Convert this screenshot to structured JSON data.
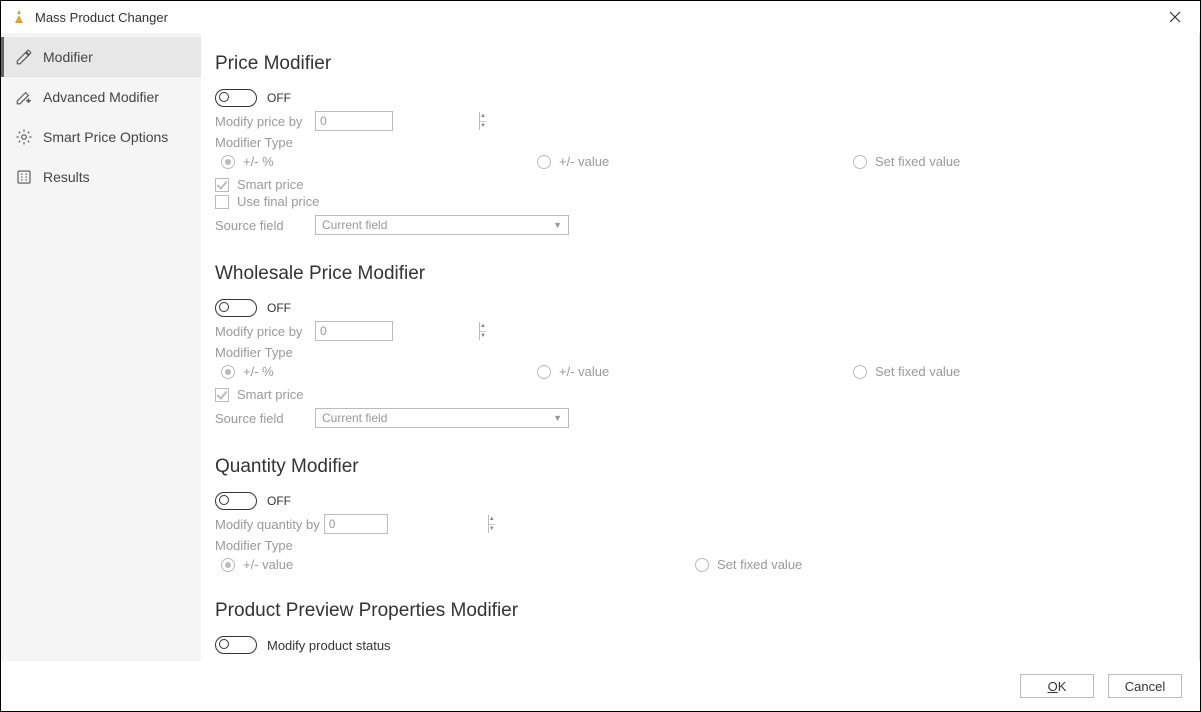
{
  "window": {
    "title": "Mass Product Changer"
  },
  "sidebar": {
    "items": [
      {
        "label": "Modifier"
      },
      {
        "label": "Advanced Modifier"
      },
      {
        "label": "Smart Price Options"
      },
      {
        "label": "Results"
      }
    ]
  },
  "sections": {
    "price": {
      "title": "Price Modifier",
      "toggle_label": "OFF",
      "modify_label": "Modify price by",
      "modify_value": "0",
      "modtype_label": "Modifier Type",
      "opts": {
        "pct": "+/- %",
        "val": "+/- value",
        "fixed": "Set fixed value"
      },
      "smart": "Smart price",
      "use_final": "Use final price",
      "source_label": "Source field",
      "source_value": "Current field"
    },
    "wholesale": {
      "title": "Wholesale Price Modifier",
      "toggle_label": "OFF",
      "modify_label": "Modify price by",
      "modify_value": "0",
      "modtype_label": "Modifier Type",
      "opts": {
        "pct": "+/- %",
        "val": "+/- value",
        "fixed": "Set fixed value"
      },
      "smart": "Smart price",
      "source_label": "Source field",
      "source_value": "Current field"
    },
    "quantity": {
      "title": "Quantity Modifier",
      "toggle_label": "OFF",
      "modify_label": "Modify quantity by",
      "modify_value": "0",
      "modtype_label": "Modifier Type",
      "opts": {
        "val": "+/- value",
        "fixed": "Set fixed value"
      }
    },
    "preview": {
      "title": "Product Preview Properties Modifier",
      "status_label": "Modify product status"
    }
  },
  "footer": {
    "ok": "OK",
    "cancel": "Cancel"
  }
}
